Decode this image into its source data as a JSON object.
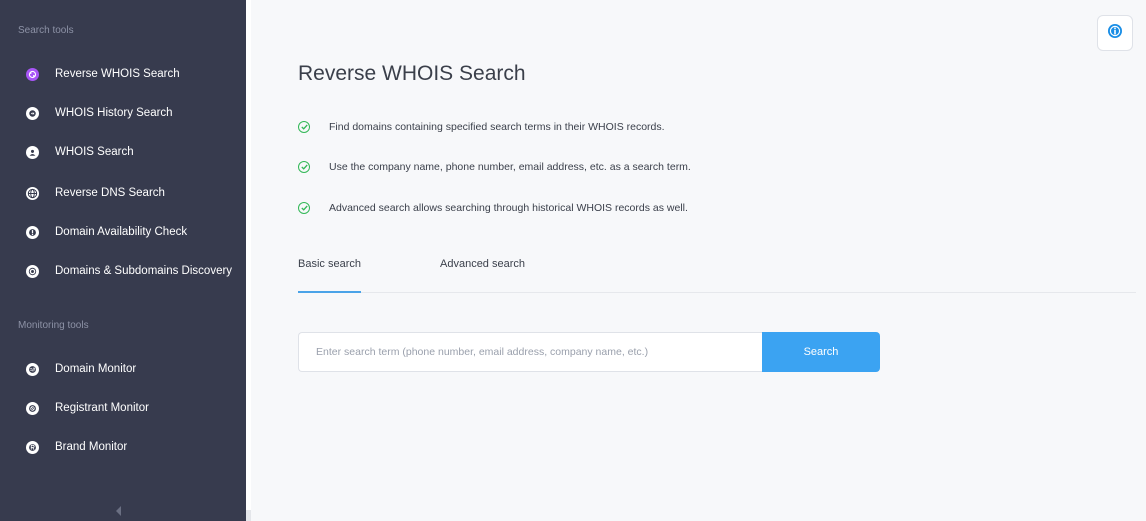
{
  "sidebar": {
    "search_tools_title": "Search tools",
    "search_items": [
      {
        "label": "Reverse WHOIS Search",
        "icon": "reverse-whois-icon",
        "active": true
      },
      {
        "label": "WHOIS History Search",
        "icon": "history-icon",
        "active": false
      },
      {
        "label": "WHOIS Search",
        "icon": "user-circle-icon",
        "active": false
      },
      {
        "label": "Reverse DNS Search",
        "icon": "globe-icon",
        "active": false
      },
      {
        "label": "Domain Availability Check",
        "icon": "exclamation-icon",
        "active": false
      },
      {
        "label": "Domains & Subdomains Discovery",
        "icon": "target-icon",
        "active": false
      }
    ],
    "monitoring_tools_title": "Monitoring tools",
    "monitoring_items": [
      {
        "label": "Domain Monitor",
        "icon": "domain-monitor-icon"
      },
      {
        "label": "Registrant Monitor",
        "icon": "registrant-icon"
      },
      {
        "label": "Brand Monitor",
        "icon": "registered-icon"
      }
    ]
  },
  "main": {
    "title": "Reverse WHOIS Search",
    "features": [
      "Find domains containing specified search terms in their WHOIS records.",
      "Use the company name, phone number, email address, etc. as a search term.",
      "Advanced search allows searching through historical WHOIS records as well."
    ],
    "tabs": [
      {
        "label": "Basic search",
        "active": true
      },
      {
        "label": "Advanced search",
        "active": false
      }
    ],
    "search": {
      "placeholder": "Enter search term (phone number, email address, company name, etc.)",
      "value": "",
      "button_label": "Search"
    }
  },
  "colors": {
    "sidebar_bg": "#373b4e",
    "accent_purple": "#a855f7",
    "primary_blue": "#3ba3f2",
    "check_green": "#33b857"
  }
}
